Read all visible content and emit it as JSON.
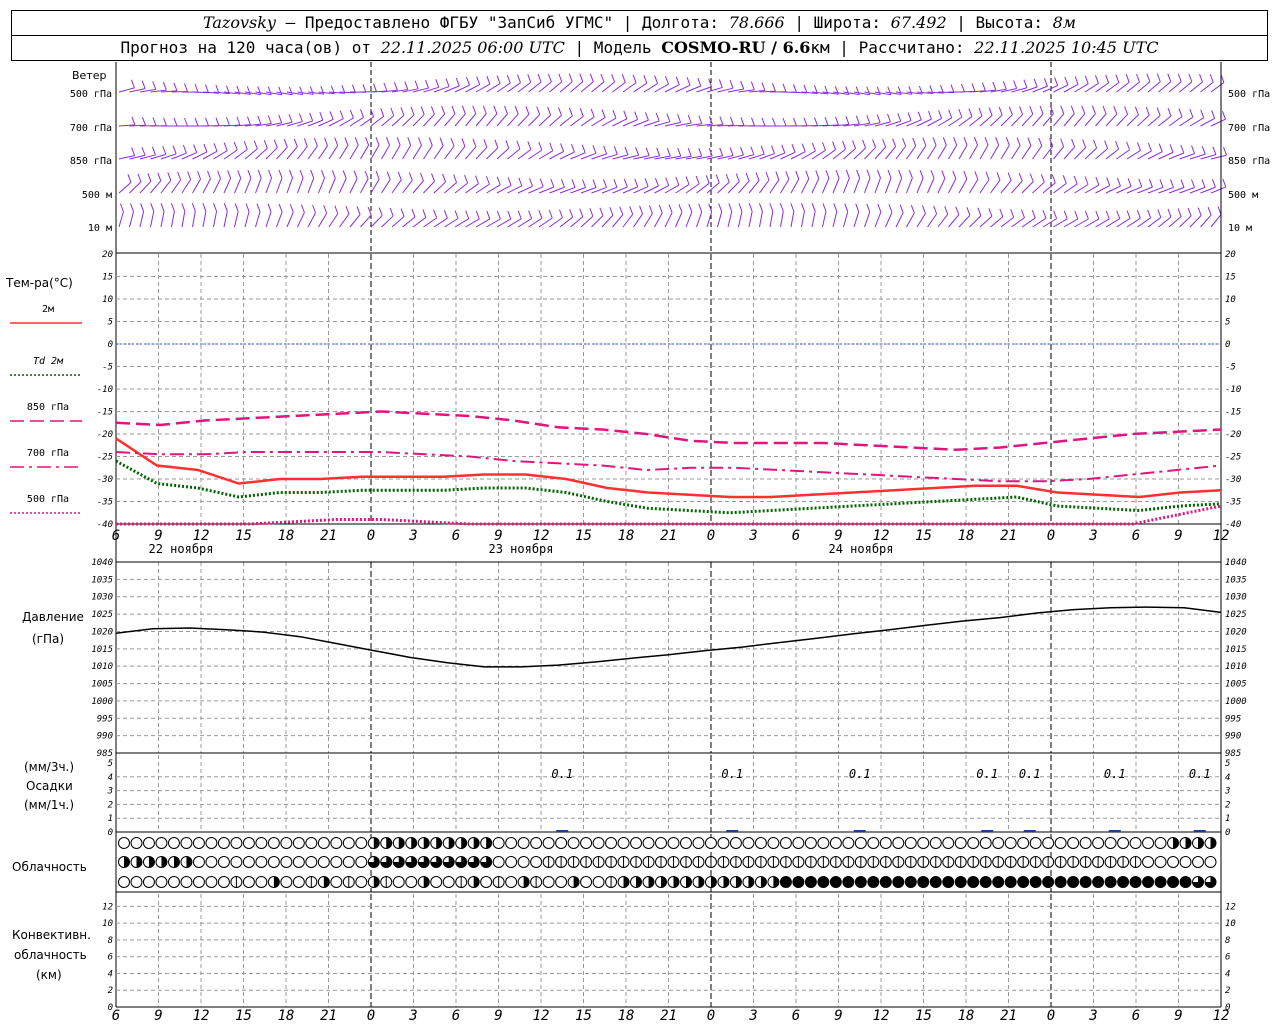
{
  "header": {
    "station": "Tazovsky",
    "provided": " — Предоставлено ФГБУ \"ЗапСиб УГМС\" | Долгота: ",
    "lon": "78.666",
    "lat_label": " | Широта: ",
    "lat": "67.492",
    "alt_label": " | Высота: ",
    "alt": "8м",
    "forecast_label": "Прогноз на 120 часа(ов) от ",
    "forecast_from": "22.11.2025 06:00 UTC",
    "model_label": " | Модель ",
    "model": "COSMO-RU / 6.6",
    "model_unit": "км",
    "calc_label": " | Рассчитано: ",
    "calc_time": "22.11.2025 10:45 UTC"
  },
  "wind_panel": {
    "title": "Ветер",
    "levels": [
      "500 гПа",
      "700 гПа",
      "850 гПа",
      "500 м",
      "10 м"
    ]
  },
  "temp_panel": {
    "title": "Тем-ра(°C)",
    "legend": [
      {
        "label": "2м",
        "color": "#ff2020",
        "style": "solid"
      },
      {
        "label": "Td 2м",
        "color": "#006400",
        "style": "dotted"
      },
      {
        "label": "850 гПа",
        "color": "#e0157d",
        "style": "dash"
      },
      {
        "label": "700 гПа",
        "color": "#e0157d",
        "style": "dashdot"
      },
      {
        "label": "500 гПа",
        "color": "#e0157d",
        "style": "dotted"
      }
    ]
  },
  "pressure_panel": {
    "title_1": "Давление",
    "title_2": "(гПа)"
  },
  "precip_panel": {
    "title_1": "(мм/3ч.)",
    "title_2": "Осадки",
    "title_3": "(мм/1ч.)"
  },
  "cloud_panel": {
    "title": "Облачность"
  },
  "conv_panel": {
    "title_1": "Конвективн.",
    "title_2": "облачность",
    "title_3": "(км)"
  },
  "date_labels": [
    "22 ноября",
    "23 ноября",
    "24 ноября"
  ],
  "x_tick_labels": [
    "6",
    "9",
    "12",
    "15",
    "18",
    "21",
    "0",
    "3",
    "6",
    "9",
    "12",
    "15",
    "18",
    "21",
    "0",
    "3",
    "6",
    "9",
    "12",
    "15",
    "18",
    "21",
    "0",
    "3",
    "6",
    "9",
    "12"
  ],
  "chart_data": [
    {
      "type": "line",
      "title": "Тем-ра(°C)",
      "x": [
        0,
        3,
        6,
        9,
        12,
        15,
        18,
        21,
        24,
        27,
        30,
        33,
        36,
        39,
        42,
        45,
        48,
        51,
        54,
        57,
        60,
        63,
        66,
        69,
        72,
        75,
        78
      ],
      "ylim": [
        -40,
        20
      ],
      "yticks": [
        20,
        15,
        10,
        5,
        0,
        -5,
        -10,
        -15,
        -20,
        -25,
        -30,
        -35,
        -40
      ],
      "series": [
        {
          "name": "2м",
          "values": [
            -21,
            -27,
            -28,
            -31,
            -30,
            -30,
            -29.5,
            -29.5,
            -29.5,
            -29,
            -29,
            -30,
            -32,
            -33,
            -33.5,
            -34,
            -34,
            -33.5,
            -33,
            -32.5,
            -32,
            -31.5,
            -31.5,
            -33,
            -33.5,
            -34,
            -33,
            -32.5
          ]
        },
        {
          "name": "Td 2м",
          "values": [
            -26,
            -31,
            -32,
            -34,
            -33,
            -33,
            -32.5,
            -32.5,
            -32.5,
            -32,
            -32,
            -33,
            -35,
            -36.5,
            -37,
            -37.5,
            -37,
            -36.5,
            -36,
            -35.5,
            -35,
            -34.5,
            -34,
            -36,
            -36.5,
            -37,
            -36,
            -35.5
          ]
        },
        {
          "name": "850 гПа",
          "values": [
            -17.5,
            -18,
            -17,
            -16.5,
            -16,
            -15.5,
            -15,
            -15.5,
            -16,
            -17,
            -18.5,
            -19,
            -20,
            -21.5,
            -22,
            -22,
            -22,
            -22.5,
            -23,
            -23.5,
            -23,
            -22,
            -21,
            -20,
            -19.5,
            -19
          ]
        },
        {
          "name": "700 гПа",
          "values": [
            -24,
            -24.5,
            -24.5,
            -24,
            -24,
            -24,
            -24,
            -24.5,
            -25,
            -26,
            -26.5,
            -27,
            -28,
            -27.5,
            -27.5,
            -28,
            -28.5,
            -29,
            -29.5,
            -30,
            -30.5,
            -30.5,
            -30,
            -29,
            -28,
            -27
          ]
        },
        {
          "name": "500 гПа",
          "values": [
            -40,
            -41,
            -40.5,
            -40,
            -39.5,
            -39,
            -39,
            -39.5,
            -40,
            -41,
            -42,
            -42,
            -42.5,
            -42,
            -42,
            -42,
            -42,
            -42,
            -42,
            -42,
            -42,
            -42,
            -41,
            -40,
            -38,
            -36
          ]
        }
      ]
    },
    {
      "type": "line",
      "title": "Давление (гПа)",
      "x": [
        0,
        3,
        6,
        9,
        12,
        15,
        18,
        21,
        24,
        27,
        30,
        33,
        36,
        39,
        42,
        45,
        48,
        51,
        54,
        57,
        60,
        63,
        66,
        69,
        72,
        75,
        78
      ],
      "ylim": [
        985,
        1040
      ],
      "yticks": [
        1040,
        1035,
        1030,
        1025,
        1020,
        1015,
        1010,
        1005,
        1000,
        995,
        990,
        985
      ],
      "series": [
        {
          "name": "Давление",
          "values": [
            1019.5,
            1020.8,
            1021,
            1020.5,
            1019.8,
            1018.5,
            1016.5,
            1014.5,
            1012.5,
            1011,
            1009.8,
            1009.8,
            1010.3,
            1011.2,
            1012.3,
            1013.3,
            1014.5,
            1015.5,
            1016.8,
            1018,
            1019.3,
            1020.5,
            1021.8,
            1023,
            1024,
            1025.3,
            1026.3,
            1026.8,
            1027,
            1026.8,
            1025.5
          ]
        }
      ]
    },
    {
      "type": "bar",
      "title": "Осадки",
      "ylim": [
        0,
        5
      ],
      "yticks": [
        5,
        4,
        3,
        2,
        1,
        0
      ],
      "annotations": [
        {
          "x": 31.5,
          "text": "0.1"
        },
        {
          "x": 43.5,
          "text": "0.1"
        },
        {
          "x": 52.5,
          "text": "0.1"
        },
        {
          "x": 61.5,
          "text": "0.1"
        },
        {
          "x": 64.5,
          "text": "0.1"
        },
        {
          "x": 70.5,
          "text": "0.1"
        },
        {
          "x": 76.5,
          "text": "0.1"
        }
      ]
    },
    {
      "type": "line",
      "title": "Конвективн. облачность (км)",
      "ylim": [
        0,
        13
      ],
      "yticks": [
        12,
        10,
        8,
        6,
        4,
        2,
        0
      ]
    }
  ],
  "colors": {
    "grid": "#9a9a9a",
    "wind": "#8a2be2",
    "pressure": "#000000",
    "zero_line": "#3050e0",
    "precip": "#1a3aaa"
  }
}
